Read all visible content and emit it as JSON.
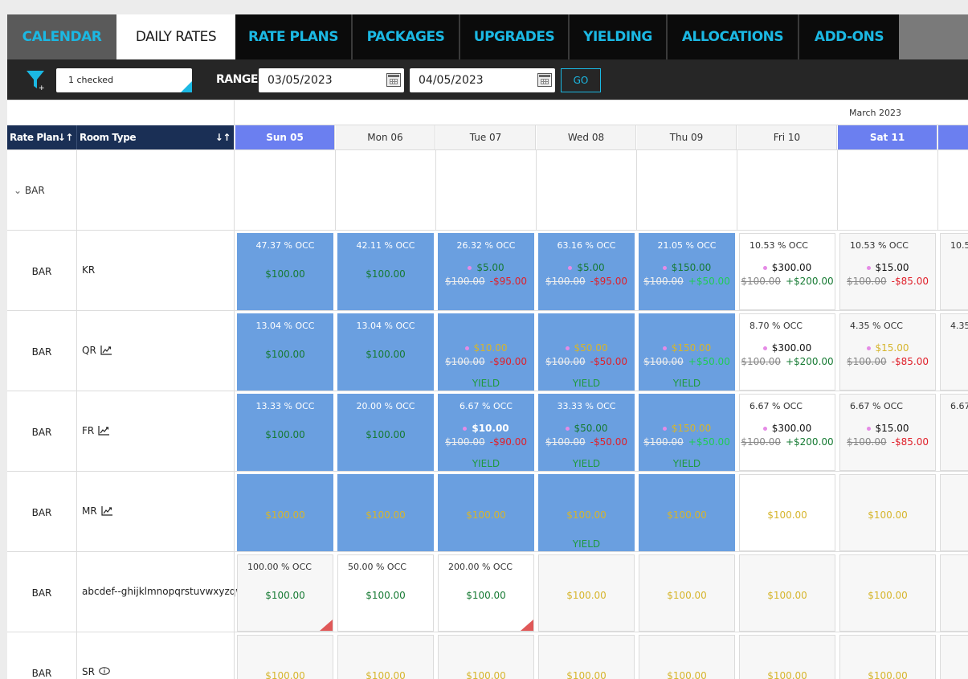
{
  "tabs": [
    {
      "label": "CALENDAR"
    },
    {
      "label": "DAILY RATES"
    },
    {
      "label": "RATE PLANS"
    },
    {
      "label": "PACKAGES"
    },
    {
      "label": "UPGRADES"
    },
    {
      "label": "YIELDING"
    },
    {
      "label": "ALLOCATIONS"
    },
    {
      "label": "ADD-ONS"
    }
  ],
  "toolbar": {
    "filter_value": "1 checked",
    "range_label": "RANGE",
    "date_from": "03/05/2023",
    "date_to": "04/05/2023",
    "go_label": "GO"
  },
  "grid": {
    "month": "March 2023",
    "col_rate_plan": "Rate Plan",
    "col_room_type": "Room Type",
    "days": [
      {
        "label": "Sun 05",
        "weekend": true
      },
      {
        "label": "Mon 06",
        "weekend": false
      },
      {
        "label": "Tue 07",
        "weekend": false
      },
      {
        "label": "Wed 08",
        "weekend": false
      },
      {
        "label": "Thu 09",
        "weekend": false
      },
      {
        "label": "Fri 10",
        "weekend": false
      },
      {
        "label": "Sat 11",
        "weekend": true
      }
    ],
    "group_label": "BAR",
    "rows": [
      {
        "rate_plan": "BAR",
        "room_type": "KR",
        "icon": "",
        "partial_occ": "10.5",
        "cells": [
          {
            "style": "blue",
            "occ": "47.37 % OCC",
            "price": "$100.00",
            "price_color": "g"
          },
          {
            "style": "blue",
            "occ": "42.11 % OCC",
            "price": "$100.00",
            "price_color": "g"
          },
          {
            "style": "blue",
            "occ": "26.32 % OCC",
            "new": "$5.00",
            "new_color": "g",
            "old": "$100.00",
            "diff": "-$95.00",
            "diff_color": "r"
          },
          {
            "style": "blue",
            "occ": "63.16 % OCC",
            "new": "$5.00",
            "new_color": "g",
            "old": "$100.00",
            "diff": "-$95.00",
            "diff_color": "r"
          },
          {
            "style": "blue",
            "occ": "21.05 % OCC",
            "new": "$150.00",
            "new_color": "g",
            "old": "$100.00",
            "diff": "+$50.00",
            "diff_color": "lg"
          },
          {
            "style": "wht",
            "occ": "10.53 % OCC",
            "new": "$300.00",
            "new_color": "blk",
            "old": "$100.00",
            "diff": "+$200.00",
            "diff_color": "g"
          },
          {
            "style": "gray",
            "occ": "10.53 % OCC",
            "new": "$15.00",
            "new_color": "blk",
            "old": "$100.00",
            "diff": "-$85.00",
            "diff_color": "r"
          }
        ]
      },
      {
        "rate_plan": "BAR",
        "room_type": "QR",
        "icon": "chart",
        "partial_occ": "4.35",
        "cells": [
          {
            "style": "blue",
            "occ": "13.04 % OCC",
            "price": "$100.00",
            "price_color": "g"
          },
          {
            "style": "blue",
            "occ": "13.04 % OCC",
            "price": "$100.00",
            "price_color": "g"
          },
          {
            "style": "blue",
            "occ": "",
            "new": "$10.00",
            "new_color": "y",
            "old": "$100.00",
            "diff": "-$90.00",
            "diff_color": "r",
            "yield": "YIELD"
          },
          {
            "style": "blue",
            "occ": "",
            "new": "$50.00",
            "new_color": "y",
            "old": "$100.00",
            "diff": "-$50.00",
            "diff_color": "r",
            "yield": "YIELD"
          },
          {
            "style": "blue",
            "occ": "",
            "new": "$150.00",
            "new_color": "y",
            "old": "$100.00",
            "diff": "+$50.00",
            "diff_color": "lg",
            "yield": "YIELD"
          },
          {
            "style": "wht",
            "occ": "8.70 % OCC",
            "new": "$300.00",
            "new_color": "blk",
            "old": "$100.00",
            "diff": "+$200.00",
            "diff_color": "g"
          },
          {
            "style": "gray",
            "occ": "4.35 % OCC",
            "new": "$15.00",
            "new_color": "y",
            "old": "$100.00",
            "diff": "-$85.00",
            "diff_color": "r"
          }
        ]
      },
      {
        "rate_plan": "BAR",
        "room_type": "FR",
        "icon": "chart",
        "partial_occ": "6.67",
        "cells": [
          {
            "style": "blue",
            "occ": "13.33 % OCC",
            "price": "$100.00",
            "price_color": "g"
          },
          {
            "style": "blue",
            "occ": "20.00 % OCC",
            "price": "$100.00",
            "price_color": "g"
          },
          {
            "style": "blue",
            "occ": "6.67 % OCC",
            "new": "$10.00",
            "new_color": "w",
            "old": "$100.00",
            "diff": "-$90.00",
            "diff_color": "r",
            "yield": "YIELD"
          },
          {
            "style": "blue",
            "occ": "33.33 % OCC",
            "new": "$50.00",
            "new_color": "g",
            "old": "$100.00",
            "diff": "-$50.00",
            "diff_color": "r",
            "yield": "YIELD"
          },
          {
            "style": "blue",
            "occ": "",
            "new": "$150.00",
            "new_color": "y",
            "old": "$100.00",
            "diff": "+$50.00",
            "diff_color": "lg",
            "yield": "YIELD"
          },
          {
            "style": "wht",
            "occ": "6.67 % OCC",
            "new": "$300.00",
            "new_color": "blk",
            "old": "$100.00",
            "diff": "+$200.00",
            "diff_color": "g"
          },
          {
            "style": "gray",
            "occ": "6.67 % OCC",
            "new": "$15.00",
            "new_color": "blk",
            "old": "$100.00",
            "diff": "-$85.00",
            "diff_color": "r"
          }
        ]
      },
      {
        "rate_plan": "BAR",
        "room_type": "MR",
        "icon": "chart",
        "partial_occ": "",
        "cells": [
          {
            "style": "blue",
            "occ": "",
            "price": "$100.00",
            "price_color": "y"
          },
          {
            "style": "blue",
            "occ": "",
            "price": "$100.00",
            "price_color": "y"
          },
          {
            "style": "blue",
            "occ": "",
            "price": "$100.00",
            "price_color": "y"
          },
          {
            "style": "blue",
            "occ": "",
            "price": "$100.00",
            "price_color": "y",
            "yield": "YIELD"
          },
          {
            "style": "blue",
            "occ": "",
            "price": "$100.00",
            "price_color": "y"
          },
          {
            "style": "wht",
            "occ": "",
            "price": "$100.00",
            "price_color": "y"
          },
          {
            "style": "gray",
            "occ": "",
            "price": "$100.00",
            "price_color": "y"
          }
        ]
      },
      {
        "rate_plan": "BAR",
        "room_type": "abcdef--ghijklmnopqrstuvwxyzqw",
        "icon": "",
        "partial_occ": "",
        "cells": [
          {
            "style": "gray",
            "occ": "100.00 % OCC",
            "price": "$100.00",
            "price_color": "g",
            "flag": true
          },
          {
            "style": "wht",
            "occ": "50.00 % OCC",
            "price": "$100.00",
            "price_color": "g"
          },
          {
            "style": "wht",
            "occ": "200.00 % OCC",
            "price": "$100.00",
            "price_color": "g",
            "flag": true
          },
          {
            "style": "gray",
            "occ": "",
            "price": "$100.00",
            "price_color": "y"
          },
          {
            "style": "gray",
            "occ": "",
            "price": "$100.00",
            "price_color": "y"
          },
          {
            "style": "gray",
            "occ": "",
            "price": "$100.00",
            "price_color": "y"
          },
          {
            "style": "gray",
            "occ": "",
            "price": "$100.00",
            "price_color": "y"
          }
        ]
      },
      {
        "rate_plan": "BAR",
        "room_type": "SR",
        "icon": "info",
        "partial_occ": "",
        "cells": [
          {
            "style": "gray",
            "occ": "",
            "price": "$100.00",
            "price_color": "y"
          },
          {
            "style": "gray",
            "occ": "",
            "price": "$100.00",
            "price_color": "y"
          },
          {
            "style": "gray",
            "occ": "",
            "price": "$100.00",
            "price_color": "y"
          },
          {
            "style": "gray",
            "occ": "",
            "price": "$100.00",
            "price_color": "y"
          },
          {
            "style": "gray",
            "occ": "",
            "price": "$100.00",
            "price_color": "y"
          },
          {
            "style": "gray",
            "occ": "",
            "price": "$100.00",
            "price_color": "y"
          },
          {
            "style": "gray",
            "occ": "",
            "price": "$100.00",
            "price_color": "y"
          }
        ]
      }
    ]
  }
}
